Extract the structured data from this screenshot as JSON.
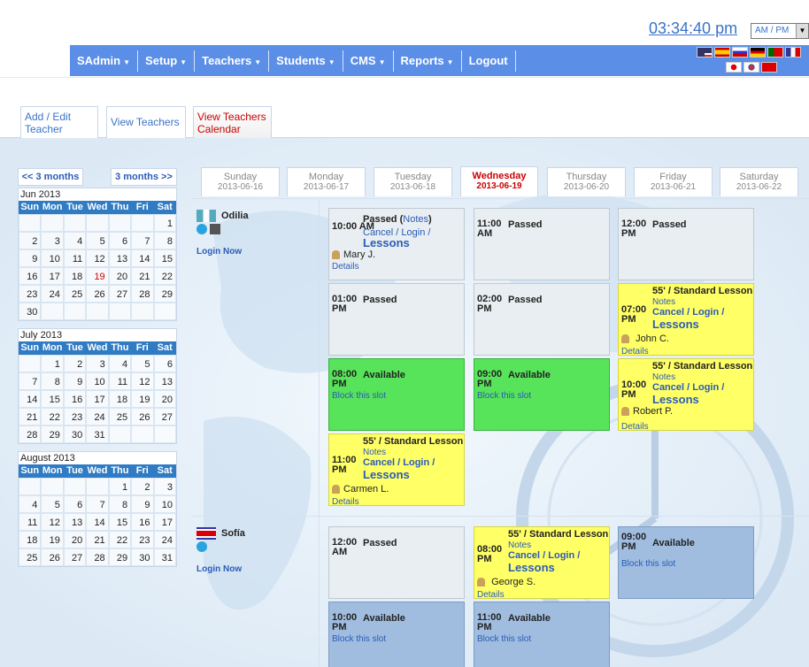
{
  "clock": {
    "time": "03:34:40 pm",
    "format_select": "AM / PM"
  },
  "nav": {
    "items": [
      {
        "label": "SAdmin",
        "caret": true
      },
      {
        "label": "Setup",
        "caret": true
      },
      {
        "label": "Teachers",
        "caret": true
      },
      {
        "label": "Students",
        "caret": true
      },
      {
        "label": "CMS",
        "caret": true
      },
      {
        "label": "Reports",
        "caret": true
      },
      {
        "label": "Logout",
        "caret": false
      }
    ]
  },
  "tabs": {
    "add_edit": "Add / Edit Teacher",
    "view_teachers": "View Teachers",
    "view_calendar": "View Teachers Calendar"
  },
  "month_nav": {
    "prev": "<< 3 months",
    "next": "3 months >>"
  },
  "calendars": [
    {
      "caption": "Jun 2013",
      "weeks": [
        [
          "",
          "",
          "",
          "",
          "",
          "",
          "1"
        ],
        [
          "2",
          "3",
          "4",
          "5",
          "6",
          "7",
          "8"
        ],
        [
          "9",
          "10",
          "11",
          "12",
          "13",
          "14",
          "15"
        ],
        [
          "16",
          "17",
          "18",
          "19",
          "20",
          "21",
          "22"
        ],
        [
          "23",
          "24",
          "25",
          "26",
          "27",
          "28",
          "29"
        ],
        [
          "30",
          "",
          "",
          "",
          "",
          "",
          ""
        ]
      ],
      "today": "19"
    },
    {
      "caption": "July 2013",
      "weeks": [
        [
          "",
          "1",
          "2",
          "3",
          "4",
          "5",
          "6"
        ],
        [
          "7",
          "8",
          "9",
          "10",
          "11",
          "12",
          "13"
        ],
        [
          "14",
          "15",
          "16",
          "17",
          "18",
          "19",
          "20"
        ],
        [
          "21",
          "22",
          "23",
          "24",
          "25",
          "26",
          "27"
        ],
        [
          "28",
          "29",
          "30",
          "31",
          "",
          "",
          ""
        ]
      ]
    },
    {
      "caption": "August 2013",
      "weeks": [
        [
          "",
          "",
          "",
          "",
          "1",
          "2",
          "3"
        ],
        [
          "4",
          "5",
          "6",
          "7",
          "8",
          "9",
          "10"
        ],
        [
          "11",
          "12",
          "13",
          "14",
          "15",
          "16",
          "17"
        ],
        [
          "18",
          "19",
          "20",
          "21",
          "22",
          "23",
          "24"
        ],
        [
          "25",
          "26",
          "27",
          "28",
          "29",
          "30",
          "31"
        ]
      ]
    }
  ],
  "weekday_headers": [
    "Sun",
    "Mon",
    "Tue",
    "Wed",
    "Thu",
    "Fri",
    "Sat"
  ],
  "days": [
    {
      "name": "Sunday",
      "date": "2013-06-16"
    },
    {
      "name": "Monday",
      "date": "2013-06-17"
    },
    {
      "name": "Tuesday",
      "date": "2013-06-18"
    },
    {
      "name": "Wednesday",
      "date": "2013-06-19"
    },
    {
      "name": "Thursday",
      "date": "2013-06-20"
    },
    {
      "name": "Friday",
      "date": "2013-06-21"
    },
    {
      "name": "Saturday",
      "date": "2013-06-22"
    }
  ],
  "teachers": [
    {
      "name": "Odilia",
      "login": "Login Now"
    },
    {
      "name": "Sofía",
      "login": "Login Now"
    }
  ],
  "slots": {
    "s1": {
      "time": "10:00 AM",
      "status": "Passed",
      "notes": "Notes",
      "cancel": "Cancel",
      "login": "Login",
      "lessons": "Lessons",
      "student": "Mary J.",
      "details": "Details"
    },
    "s2": {
      "time": "11:00 AM",
      "status": "Passed"
    },
    "s3": {
      "time": "12:00 PM",
      "status": "Passed"
    },
    "s4": {
      "time": "01:00 PM",
      "status": "Passed"
    },
    "s5": {
      "time": "02:00 PM",
      "status": "Passed"
    },
    "s6": {
      "time": "07:00 PM",
      "title": "55' / Standard Lesson",
      "notes": "Notes",
      "cancel": "Cancel",
      "login": "Login",
      "lessons": "Lessons",
      "student": "John C.",
      "details": "Details"
    },
    "s7": {
      "time": "08:00 PM",
      "status": "Available",
      "block": "Block this slot"
    },
    "s8": {
      "time": "09:00 PM",
      "status": "Available",
      "block": "Block this slot"
    },
    "s9": {
      "time": "10:00 PM",
      "title": "55' / Standard Lesson",
      "notes": "Notes",
      "cancel": "Cancel",
      "login": "Login",
      "lessons": "Lessons",
      "student": "Robert P.",
      "details": "Details"
    },
    "s10": {
      "time": "11:00 PM",
      "title": "55' / Standard Lesson",
      "notes": "Notes",
      "cancel": "Cancel",
      "login": "Login",
      "lessons": "Lessons",
      "student": "Carmen L.",
      "details": "Details"
    },
    "s11": {
      "time": "12:00 AM",
      "status": "Passed"
    },
    "s12": {
      "time": "08:00 PM",
      "title": "55' / Standard Lesson",
      "notes": "Notes",
      "cancel": "Cancel",
      "login": "Login",
      "lessons": "Lessons",
      "student": "George S.",
      "details": "Details"
    },
    "s13": {
      "time": "09:00 PM",
      "status": "Available",
      "block": "Block this slot"
    },
    "s14": {
      "time": "10:00 PM",
      "status": "Available",
      "block": "Block this slot"
    },
    "s15": {
      "time": "11:00 PM",
      "status": "Available",
      "block": "Block this slot"
    }
  },
  "colors": {
    "nav": "#5b8ee6",
    "available_green": "#57e35a",
    "available_blue": "#a0bde0",
    "lesson": "#ffff66",
    "passed": "#e8eef1",
    "link": "#2a5cb8",
    "active": "#cc0000"
  }
}
